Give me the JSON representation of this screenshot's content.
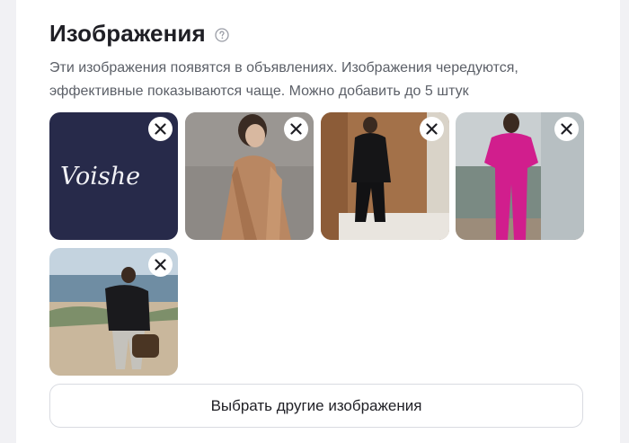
{
  "section": {
    "title": "Изображения",
    "description_line1": "Эти изображения появятся в объявлениях. Изображения чередуются,",
    "description_line2": "эффективные показываются чаще. Можно добавить до 5 штук"
  },
  "images": [
    {
      "name": "logo-image",
      "logo_text": "Voishe"
    },
    {
      "name": "beige-coat-photo"
    },
    {
      "name": "black-outfit-photo"
    },
    {
      "name": "pink-suit-photo"
    },
    {
      "name": "beach-jacket-photo"
    }
  ],
  "choose_button": {
    "label": "Выбрать другие изображения"
  },
  "icons": {
    "help": "question-circle-icon",
    "remove": "close-icon"
  },
  "colors": {
    "logo_bg": "#272a4a",
    "title": "#1f1f25",
    "text": "#5c6068",
    "border": "#d9dbe1"
  }
}
